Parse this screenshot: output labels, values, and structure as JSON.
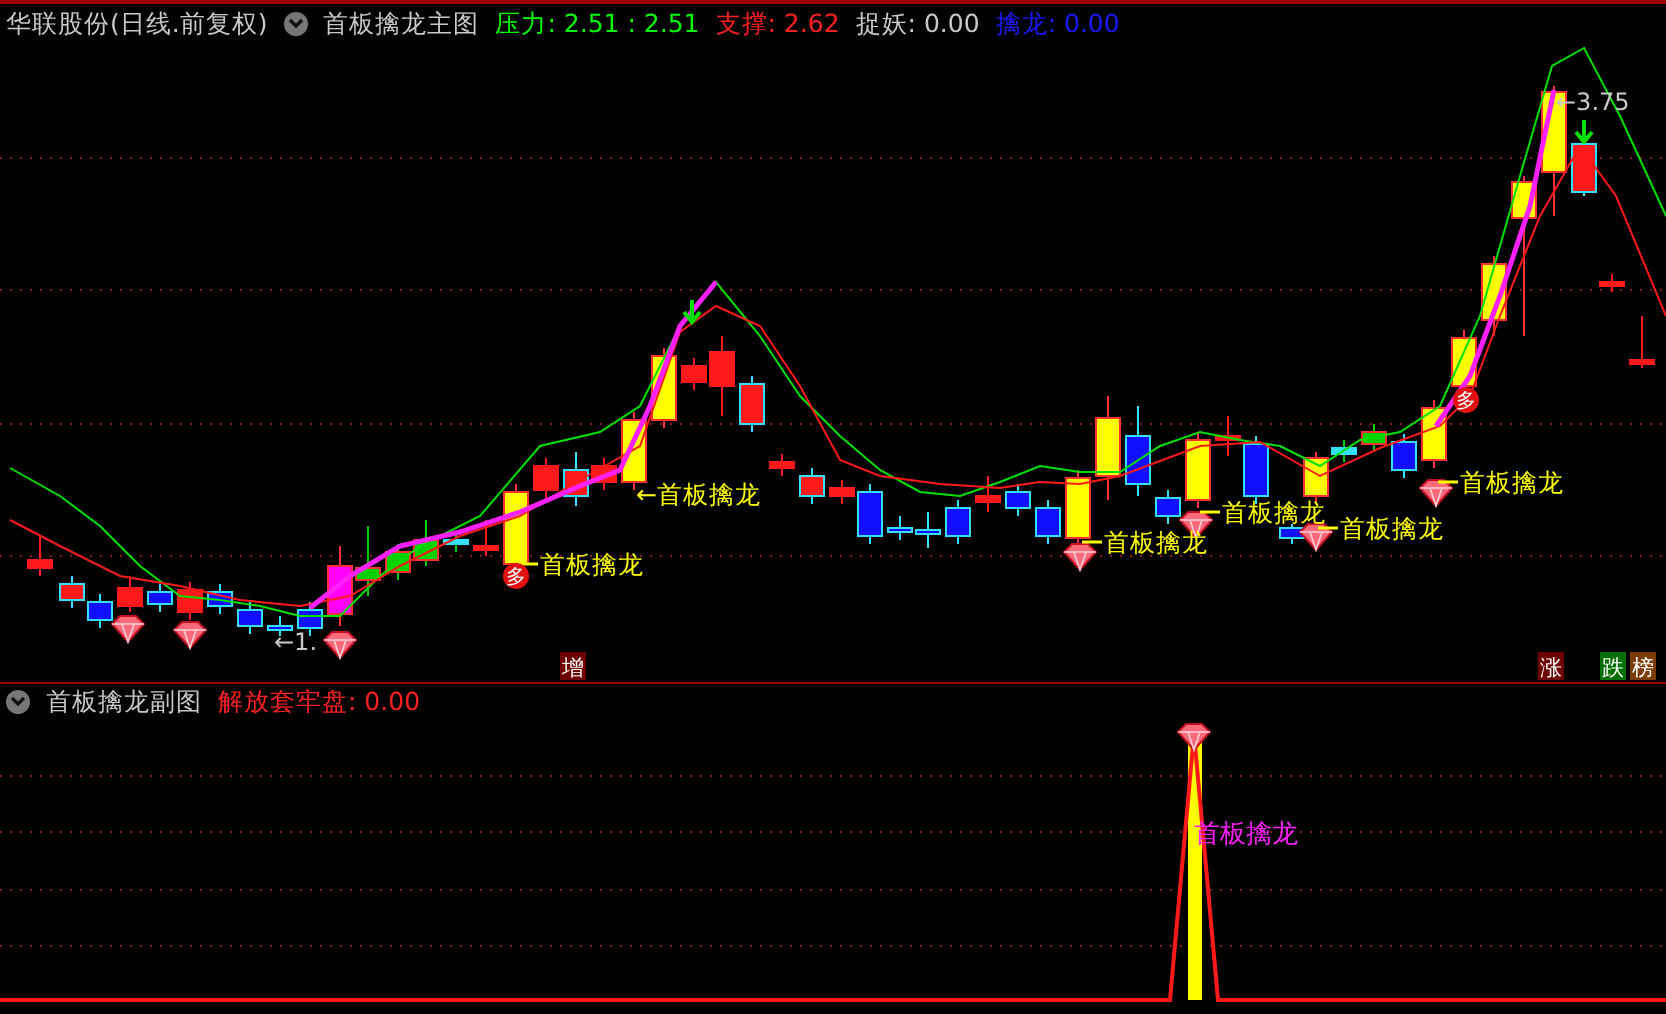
{
  "main_header": {
    "title": "华联股份(日线.前复权)",
    "indicator": "首板擒龙主图",
    "readings": [
      {
        "text": "压力: 2.51  : 2.51",
        "color": "#00ff00"
      },
      {
        "text": "支撑: 2.62",
        "color": "#ff2020"
      },
      {
        "text": "捉妖: 0.00",
        "color": "#c8c8c8"
      },
      {
        "text": "擒龙: 0.00",
        "color": "#1a1aff"
      }
    ]
  },
  "main_chart": {
    "signals": [
      {
        "kind": "label",
        "text": "首板擒龙"
      },
      {
        "kind": "arrow-label",
        "text": "←首板擒龙"
      },
      {
        "kind": "label",
        "text": "首板擒龙"
      },
      {
        "kind": "label",
        "text": "首板擒龙"
      },
      {
        "kind": "label",
        "text": "首板擒龙"
      },
      {
        "kind": "label",
        "text": "首板擒龙"
      }
    ],
    "price_marks": [
      {
        "text": "←1."
      },
      {
        "text": "←3.75"
      }
    ],
    "badges": [
      {
        "text": "多"
      },
      {
        "text": "多"
      }
    ],
    "tags": [
      {
        "text": "增",
        "color": "#6e0000"
      },
      {
        "text": "涨",
        "color": "#6e0000"
      },
      {
        "text": "跌",
        "color": "#006e00"
      },
      {
        "text": "榜",
        "color": "#7a3c00"
      }
    ]
  },
  "sub_header": {
    "title": "首板擒龙副图",
    "reading": "解放套牢盘: 0.00"
  },
  "sub_chart": {
    "label": "首板擒龙"
  }
}
